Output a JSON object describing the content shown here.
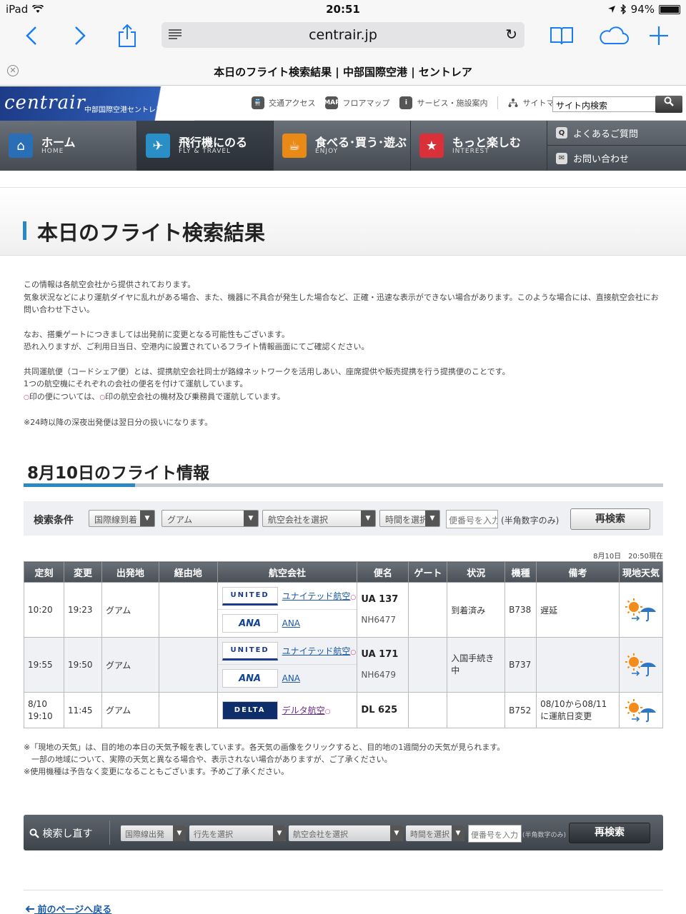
{
  "status": {
    "device": "iPad",
    "time": "20:51",
    "battery": "94%"
  },
  "browser": {
    "url": "centrair.jp",
    "tab_title": "本日のフライト検索結果 | 中部国際空港 | セントレア"
  },
  "header": {
    "logo": "centrair",
    "logo_sub": "中部国際空港セントレア",
    "links": [
      {
        "icon": "train-icon",
        "label": "交通アクセス"
      },
      {
        "icon": "map-icon",
        "label": "フロアマップ",
        "badge": "MAP"
      },
      {
        "icon": "info-icon",
        "label": "サービス・施設案内",
        "badge": "i"
      },
      {
        "icon": "sitemap-icon",
        "label": "サイトマップ"
      }
    ],
    "search_value": "サイト内検索"
  },
  "nav": [
    {
      "label": "ホーム",
      "sub": "HOME",
      "icon": "home-icon",
      "color": "#2a6fb5"
    },
    {
      "label": "飛行機にのる",
      "sub": "FLY & TRAVEL",
      "icon": "airplane-icon",
      "color": "#2a8fc6"
    },
    {
      "label": "食べる･買う･遊ぶ",
      "sub": "ENJOY",
      "icon": "cup-icon",
      "color": "#e98a17"
    },
    {
      "label": "もっと楽しむ",
      "sub": "INTEREST",
      "icon": "star-icon",
      "color": "#d9303a"
    }
  ],
  "nav_mini": [
    {
      "label": "よくあるご質問",
      "badge": "Q"
    },
    {
      "label": "お問い合わせ",
      "badge": "✉"
    }
  ],
  "page_title": "本日のフライト検索結果",
  "intro": {
    "p1a": "この情報は各航空会社から提供されております。",
    "p1b": "気象状況などにより運航ダイヤに乱れがある場合、また、機器に不具合が発生した場合など、正確・迅速な表示ができない場合があります。このような場合には、直接航空会社にお問い合わせ下さい。",
    "p2a": "なお、搭乗ゲートにつきましては出発前に変更となる可能性もございます。",
    "p2b": "恐れ入りますが、ご利用日当日、空港内に設置されているフライト情報画面にてご確認ください。",
    "p3a": "共同運航便（コードシェア便）とは、提携航空会社同士が路線ネットワークを活用しあい、座席提供や販売提携を行う提携便のことです。",
    "p3b": "1つの航空機にそれぞれの会社の便名を付けて運航しています。",
    "p3c_1": "印の便については、",
    "p3c_2": "印の航空会社の機材及び乗務員で運航しています。",
    "p4": "※24時以降の深夜出発便は翌日分の扱いになります。"
  },
  "section_title": "8月10日のフライト情報",
  "search": {
    "label": "検索条件",
    "type": "国際線到着",
    "origin": "グアム",
    "airline": "航空会社を選択",
    "time": "時間を選択",
    "flight_placeholder": "便番号を入力",
    "hint": "(半角数字のみ)",
    "button": "再検索"
  },
  "as_of": "8月10日　20:50現在",
  "table": {
    "headers": [
      "定刻",
      "変更",
      "出発地",
      "経由地",
      "航空会社",
      "便名",
      "ゲート",
      "状況",
      "機種",
      "備考",
      "現地天気"
    ],
    "rows": [
      {
        "sched": "10:20",
        "sched2": "",
        "changed": "19:23",
        "origin": "グアム",
        "via": "",
        "airlines": [
          {
            "logo": "UNITED",
            "name": "ユナイテッド航空",
            "mark": "○"
          },
          {
            "logo": "ANA",
            "name": "ANA",
            "mark": ""
          }
        ],
        "flight_main": "UA 137",
        "flight_sub": "NH6477",
        "gate": "",
        "status": "到着済み",
        "aircraft": "B738",
        "remarks": "遅延",
        "weather": "sunny-rain-icon"
      },
      {
        "sched": "19:55",
        "sched2": "",
        "changed": "19:50",
        "origin": "グアム",
        "via": "",
        "airlines": [
          {
            "logo": "UNITED",
            "name": "ユナイテッド航空",
            "mark": "○"
          },
          {
            "logo": "ANA",
            "name": "ANA",
            "mark": ""
          }
        ],
        "flight_main": "UA 171",
        "flight_sub": "NH6479",
        "gate": "",
        "status": "入国手続き中",
        "aircraft": "B737",
        "remarks": "",
        "weather": "sunny-rain-icon"
      },
      {
        "sched": "8/10",
        "sched2": "19:10",
        "changed": "11:45",
        "origin": "グアム",
        "via": "",
        "airlines": [
          {
            "logo": "DELTA",
            "name": "デルタ航空",
            "mark": "○"
          }
        ],
        "flight_main": "DL 625",
        "flight_sub": "",
        "gate": "",
        "status": "",
        "aircraft": "B752",
        "remarks": "08/10から08/11に運航日変更",
        "weather": "sunny-rain-icon"
      }
    ]
  },
  "notes": {
    "n1": "※「現地の天気」は、目的地の本日の天気予報を表しています。各天気の画像をクリックすると、目的地の1週間分の天気が見られます。",
    "n2": "　一部の地域について、実際の天気と異なる場合や、表示されない場合がありますが、ご了承ください。",
    "n3": "※使用機種は予告なく変更になることもございます。予めご了承ください。"
  },
  "research": {
    "label": "検索し直す",
    "type": "国際線出発",
    "dest": "行先を選択",
    "airline": "航空会社を選択",
    "time": "時間を選択",
    "flight_placeholder": "便番号を入力",
    "hint": "(半角数字のみ)",
    "button": "再検索"
  },
  "back_link": "前のページへ戻る"
}
